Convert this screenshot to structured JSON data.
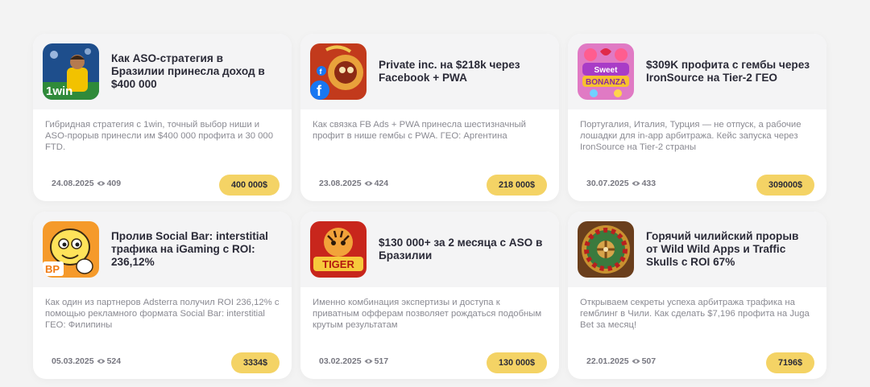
{
  "cards": [
    {
      "title": "Как ASO-стратегия в Бразилии принесла доход в $400 000",
      "description": "Гибридная стратегия с 1win, точный выбор ниши и ASO-прорыв принесли им $400 000 профита и 30 000 FTD.",
      "date": "24.08.2025",
      "views": "409",
      "price": "400 000$",
      "thumb_icon": "1win-football-player-icon",
      "thumb_text": "1win"
    },
    {
      "title": "Private inc. на $218k через Facebook + PWA",
      "description": "Как связка FB Ads + PWA принесла шестизначный профит в нише гембы с PWA. ГЕО: Аргентина",
      "date": "23.08.2025",
      "views": "424",
      "price": "218 000$",
      "thumb_icon": "facebook-gambling-icon"
    },
    {
      "title": "$309K профита с гембы через IronSource на Tier-2 ГЕО",
      "description": "Португалия, Италия, Турция — не отпуск, а рабочие лошадки для in-app арбитража. Кейс запуска через IronSource на Tier-2 страны",
      "date": "30.07.2025",
      "views": "433",
      "price": "309000$",
      "thumb_icon": "sweet-bonanza-icon",
      "thumb_text": "Sweet BONANZA"
    },
    {
      "title": "Пролив Social Bar: interstitial трафика на iGaming с ROI: 236,12%",
      "description": "Как один из партнеров Adsterra получил ROI 236,12% с помощью рекламного формата Social Bar: interstitial ГЕО: Филипины",
      "date": "05.03.2025",
      "views": "524",
      "price": "3334$",
      "thumb_icon": "mascot-thumbs-up-icon",
      "thumb_text": "BP"
    },
    {
      "title": "$130 000+ за 2 месяца с ASO в Бразилии",
      "description": "Именно комбинация экспертизы и доступа к приватным офферам позволяет рождаться подобным крутым результатам",
      "date": "03.02.2025",
      "views": "517",
      "price": "130 000$",
      "thumb_icon": "fortune-tiger-icon",
      "thumb_text": "TIGER"
    },
    {
      "title": "Горячий чилийский прорыв от Wild Wild Apps и Traffic Skulls с ROI 67%",
      "description": "Открываем секреты успеха арбитража трафика на гемблинг в Чили. Как сделать $7,196 профита на Juga Bet за месяц!",
      "date": "22.01.2025",
      "views": "507",
      "price": "7196$",
      "thumb_icon": "roulette-wheel-icon"
    }
  ]
}
